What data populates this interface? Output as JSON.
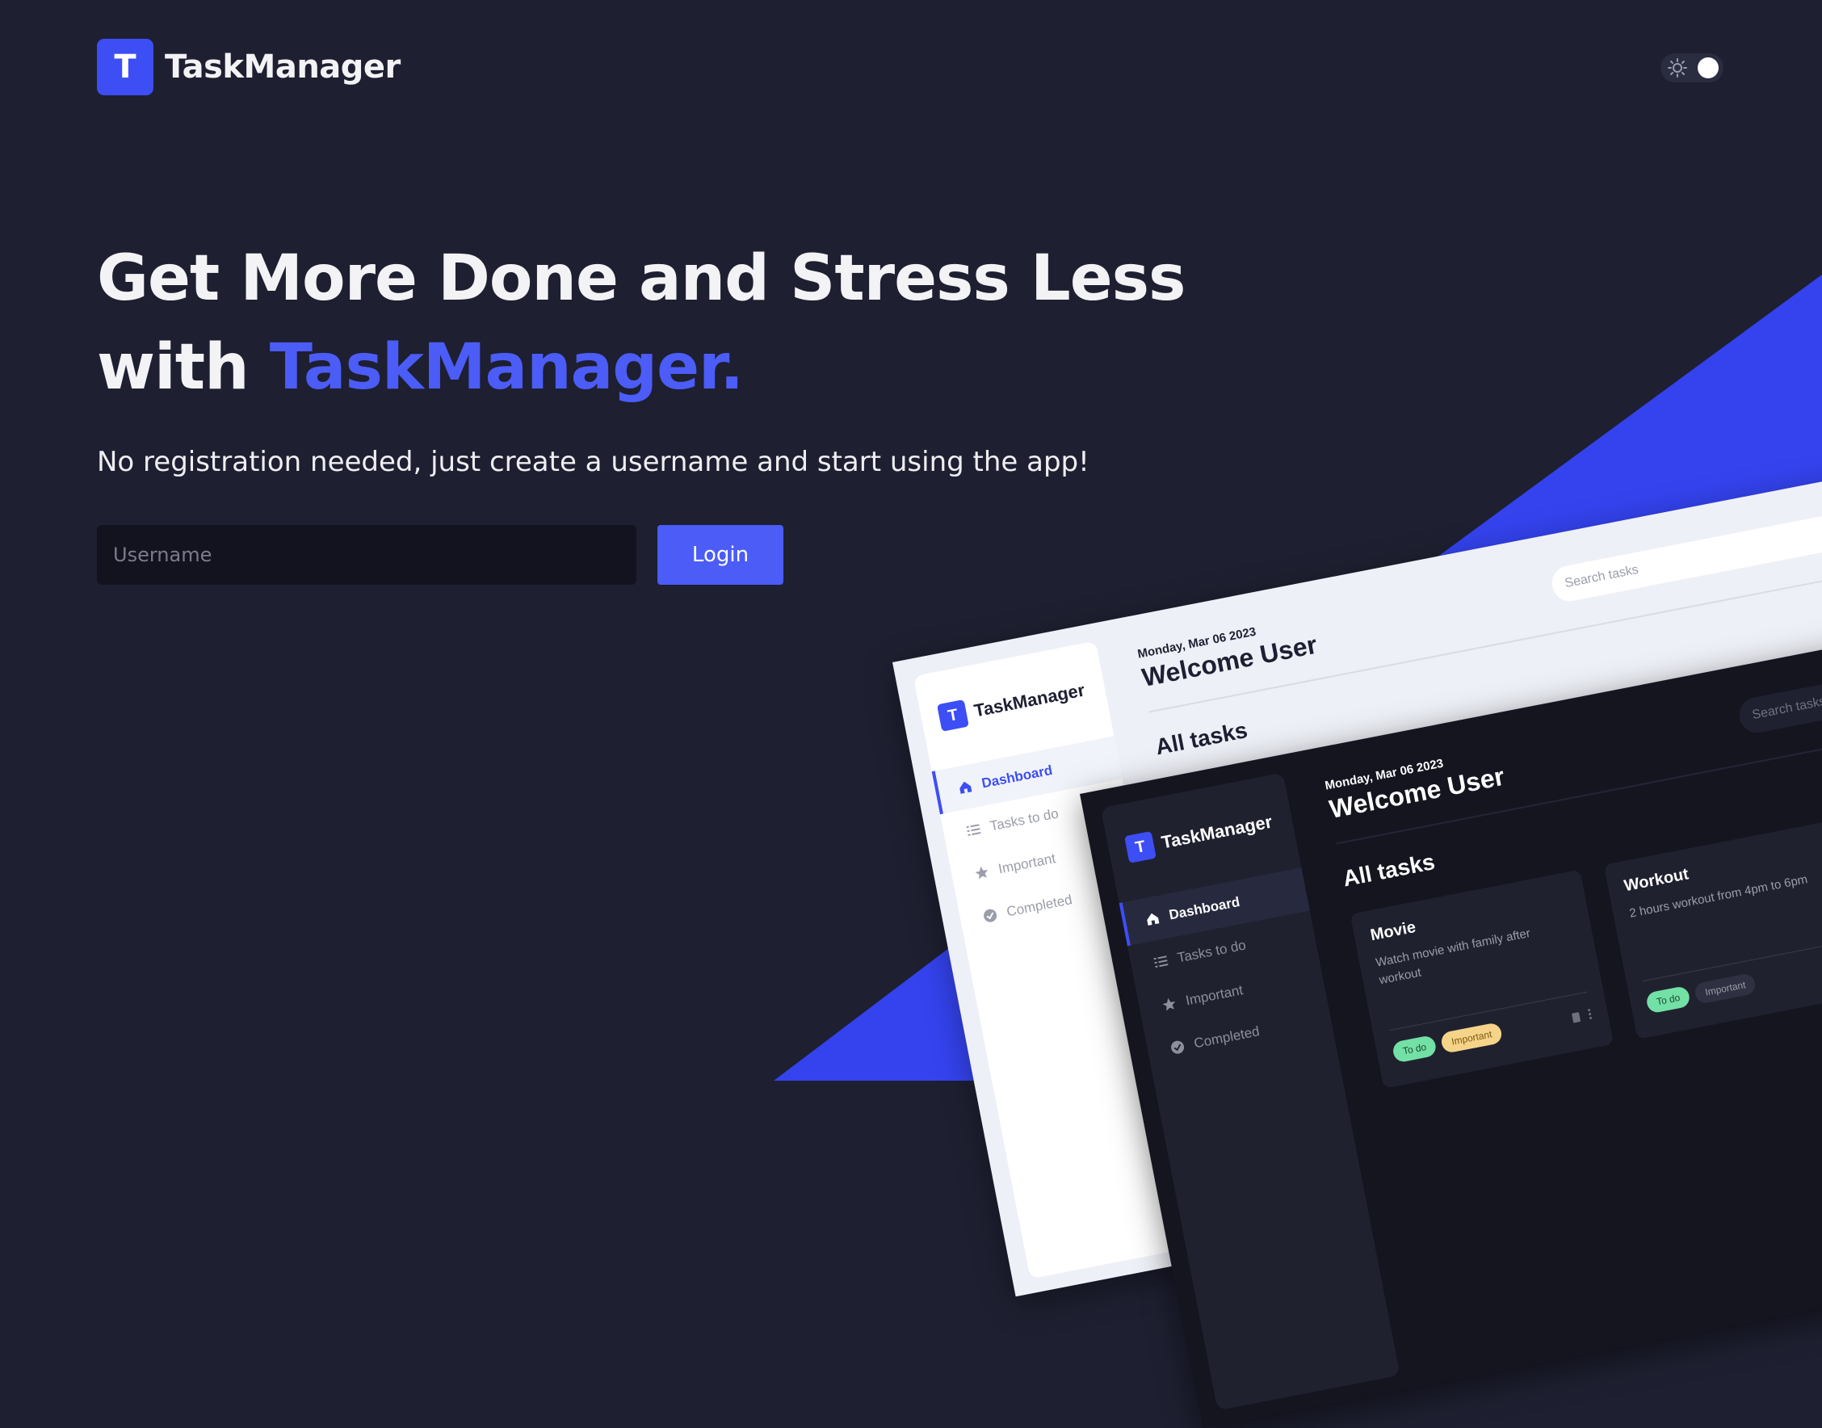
{
  "app": {
    "logo_letter": "T",
    "name": "TaskManager"
  },
  "hero": {
    "title_line1": "Get More Done and Stress Less",
    "title_line2_prefix": "with ",
    "title_line2_accent": "TaskManager.",
    "subtitle": "No registration needed, just create a username and start using the app!"
  },
  "login_form": {
    "username_placeholder": "Username",
    "username_value": "",
    "login_label": "Login"
  },
  "theme_toggle": {
    "icon": "sun-icon"
  },
  "preview": {
    "logo_letter": "T",
    "app_name": "TaskManager",
    "nav": [
      {
        "label": "Dashboard",
        "icon": "home-icon"
      },
      {
        "label": "Tasks to do",
        "icon": "list-icon"
      },
      {
        "label": "Important",
        "icon": "star-icon"
      },
      {
        "label": "Completed",
        "icon": "check-circle-icon"
      }
    ],
    "date": "Monday, Mar 06 2023",
    "welcome": "Welcome User",
    "search_placeholder": "Search tasks",
    "section_title": "All tasks",
    "cards": [
      {
        "title": "Movie",
        "description": "Watch movie with family after workout",
        "tags": [
          "To do",
          "Important"
        ]
      },
      {
        "title": "Workout",
        "description": "2 hours workout from 4pm to 6pm",
        "tags": [
          "To do",
          "Important"
        ]
      }
    ]
  },
  "colors": {
    "background": "#1e1f30",
    "accent": "#4b5cf7",
    "brand_blue": "#3d4ef5",
    "input_bg": "#131320"
  }
}
